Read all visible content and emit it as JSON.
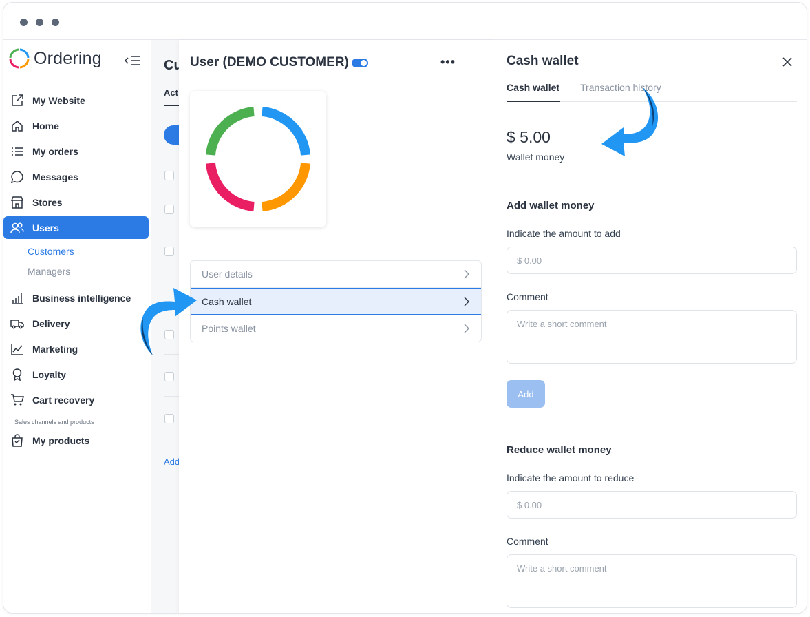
{
  "app": {
    "brand_name": "Ordering",
    "brand_colors": [
      "#4caf50",
      "#2196f3",
      "#e91e63",
      "#ff9800"
    ],
    "accent_color": "#2c7be5"
  },
  "sidebar": {
    "items": [
      {
        "label": "My Website",
        "icon": "external-link-icon"
      },
      {
        "label": "Home",
        "icon": "home-icon"
      },
      {
        "label": "My orders",
        "icon": "list-icon"
      },
      {
        "label": "Messages",
        "icon": "chat-icon"
      },
      {
        "label": "Stores",
        "icon": "store-icon"
      },
      {
        "label": "Users",
        "icon": "users-icon",
        "active": true
      }
    ],
    "sub_items": [
      {
        "label": "Customers",
        "active": true
      },
      {
        "label": "Managers"
      }
    ],
    "items2": [
      {
        "label": "Business intelligence",
        "icon": "bar-chart-icon"
      },
      {
        "label": "Delivery",
        "icon": "truck-icon"
      },
      {
        "label": "Marketing",
        "icon": "trend-icon"
      },
      {
        "label": "Loyalty",
        "icon": "award-icon"
      },
      {
        "label": "Cart recovery",
        "icon": "cart-icon"
      }
    ],
    "section_label": "Sales channels and products",
    "items3": [
      {
        "label": "My products",
        "icon": "bag-icon"
      }
    ]
  },
  "background": {
    "title_fragment": "Cu",
    "tab_fragment": "Act",
    "add_fragment": "Add"
  },
  "user_panel": {
    "title": "User (DEMO CUSTOMER)",
    "more_label": "•••",
    "menu": [
      {
        "label": "User details",
        "active": false
      },
      {
        "label": "Cash wallet",
        "active": true
      },
      {
        "label": "Points wallet",
        "active": false
      }
    ]
  },
  "wallet": {
    "title": "Cash wallet",
    "tabs": [
      {
        "label": "Cash wallet",
        "active": true
      },
      {
        "label": "Transaction history",
        "active": false
      }
    ],
    "amount": "$ 5.00",
    "amount_label": "Wallet money",
    "add": {
      "heading": "Add wallet money",
      "amount_label": "Indicate the amount to add",
      "amount_placeholder": "$ 0.00",
      "comment_label": "Comment",
      "comment_placeholder": "Write a short comment",
      "button": "Add"
    },
    "reduce": {
      "heading": "Reduce wallet money",
      "amount_label": "Indicate the amount to reduce",
      "amount_placeholder": "$ 0.00",
      "comment_label": "Comment",
      "comment_placeholder": "Write a short comment"
    }
  }
}
